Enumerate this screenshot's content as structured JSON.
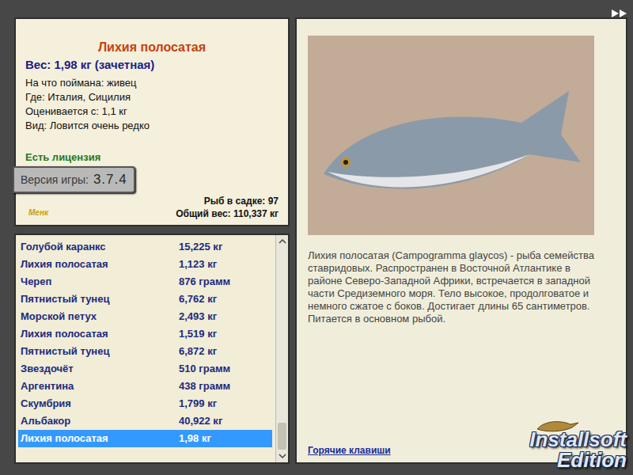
{
  "catch": {
    "title": "Лихия полосатая",
    "weight": "Вес: 1,98 кг (зачетная)",
    "details": [
      "На что поймана: живец",
      "Где: Италия, Сицилия",
      "Оценивается с: 1,1 кг",
      "Вид: Ловится очень редко"
    ],
    "license": "Есть лицензия",
    "version_label": "Версия игры:",
    "version": "3.7.4",
    "logo": "Менк",
    "stats": [
      "Рыб в садке: 97",
      "Общий вес: 110,337 кг"
    ]
  },
  "catch_list": {
    "rows": [
      {
        "name": "Голубой каранкс",
        "weight": "15,225 кг",
        "selected": false
      },
      {
        "name": "Лихия полосатая",
        "weight": "1,123 кг",
        "selected": false
      },
      {
        "name": "Череп",
        "weight": "876 грамм",
        "selected": false
      },
      {
        "name": "Пятнистый тунец",
        "weight": "6,762 кг",
        "selected": false
      },
      {
        "name": "Морской петух",
        "weight": "2,493 кг",
        "selected": false
      },
      {
        "name": "Лихия полосатая",
        "weight": "1,519 кг",
        "selected": false
      },
      {
        "name": "Пятнистый тунец",
        "weight": "6,872 кг",
        "selected": false
      },
      {
        "name": "Звездочёт",
        "weight": "510 грамм",
        "selected": false
      },
      {
        "name": "Аргентина",
        "weight": "438 грамм",
        "selected": false
      },
      {
        "name": "Скумбрия",
        "weight": "1,799 кг",
        "selected": false
      },
      {
        "name": "Альбакор",
        "weight": "40,922 кг",
        "selected": false
      },
      {
        "name": "Лихия полосатая",
        "weight": "1,98 кг",
        "selected": true
      }
    ]
  },
  "description": "Лихия полосатая (Campogramma glaycos) - рыба семейства ставридовых. Распространен в Восточной Атлантике в районе Северо-Западной Африки, встречается в западной части Средиземного моря. Тело высокое, продолговатое и немного сжатое с боков. Достигает длины 65 сантиметров. Питается в основном рыбой.",
  "hotkeys": "Горячие клавиши",
  "branding": [
    "Installsoft",
    "Edition"
  ]
}
